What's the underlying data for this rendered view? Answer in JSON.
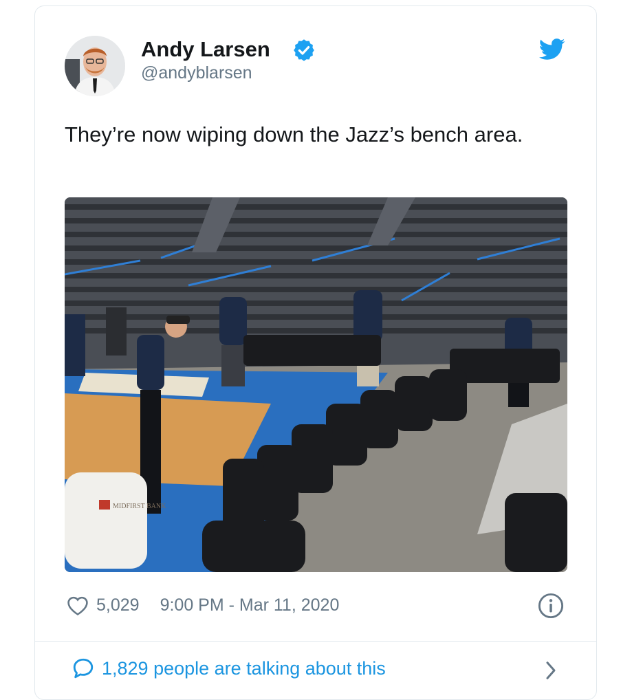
{
  "author": {
    "name": "Andy Larsen",
    "handle": "@andyblarsen",
    "verified": true
  },
  "tweet": {
    "text": "They’re now wiping down the Jazz’s bench area."
  },
  "photo": {
    "banner_text": "MIDFIRST BANK"
  },
  "meta": {
    "likes": "5,029",
    "timestamp": "9:00 PM - Mar 11, 2020"
  },
  "footer": {
    "talking": "1,829 people are talking about this"
  },
  "icons": {
    "verified": "verified-badge-icon",
    "brand": "twitter-bird-icon",
    "like": "heart-icon",
    "info": "info-icon",
    "reply": "speech-bubble-icon",
    "more": "chevron-right-icon"
  },
  "colors": {
    "accent": "#1da1f2",
    "link": "#1b95e0",
    "text": "#14171a",
    "muted": "#657786",
    "border": "#e1e8ed"
  }
}
